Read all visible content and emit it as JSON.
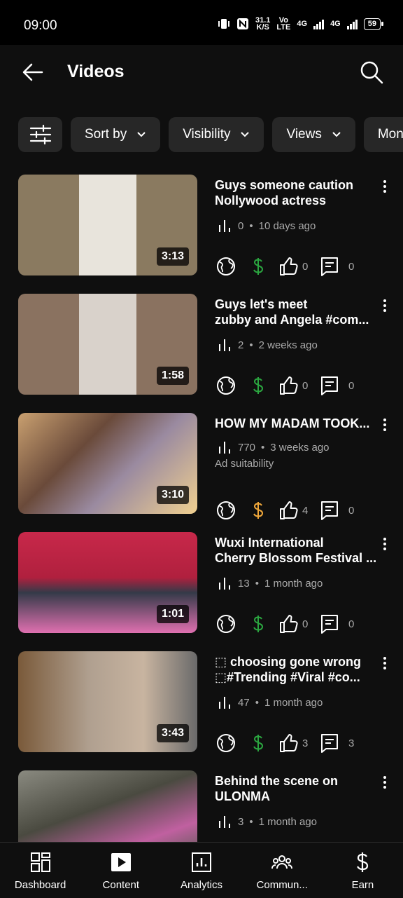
{
  "status": {
    "time": "09:00",
    "speed_value": "31.1",
    "speed_unit": "K/S",
    "volte_top": "Vo",
    "volte_bottom": "LTE",
    "net1": "4G",
    "net2": "4G",
    "battery": "59"
  },
  "header": {
    "title": "Videos"
  },
  "chips": [
    {
      "label": "Sort by"
    },
    {
      "label": "Visibility"
    },
    {
      "label": "Views"
    },
    {
      "label": "Mon"
    }
  ],
  "colors": {
    "monetized": "#2ba640",
    "limited": "#f2a93b",
    "background": "#0f0f0f",
    "chip": "#272727"
  },
  "videos": [
    {
      "title1": "Guys someone caution",
      "title2": "Nollywood actress",
      "views": "0",
      "age": "10 days ago",
      "duration": "3:13",
      "ad_suitability": "",
      "monetization": "monetized",
      "likes": "0",
      "comments": "0"
    },
    {
      "title1": "Guys let's meet",
      "title2": "zubby and Angela #com...",
      "views": "2",
      "age": "2 weeks ago",
      "duration": "1:58",
      "ad_suitability": "",
      "monetization": "monetized",
      "likes": "0",
      "comments": "0"
    },
    {
      "title1": "HOW MY MADAM TOOK...",
      "title2": "",
      "views": "770",
      "age": "3 weeks ago",
      "duration": "3:10",
      "ad_suitability": "Ad suitability",
      "monetization": "limited",
      "likes": "4",
      "comments": "0"
    },
    {
      "title1": "Wuxi International",
      "title2": "Cherry Blossom Festival ...",
      "views": "13",
      "age": "1 month ago",
      "duration": "1:01",
      "ad_suitability": "",
      "monetization": "monetized",
      "likes": "0",
      "comments": "0"
    },
    {
      "title1": "⬚ choosing gone wrong",
      "title2": "⬚#Trending #Viral #co...",
      "views": "47",
      "age": "1 month ago",
      "duration": "3:43",
      "ad_suitability": "",
      "monetization": "monetized",
      "likes": "3",
      "comments": "3"
    },
    {
      "title1": "Behind the scene on",
      "title2": "ULONMA",
      "views": "3",
      "age": "1 month ago",
      "duration": "",
      "ad_suitability": "",
      "monetization": "monetized",
      "likes": "",
      "comments": ""
    }
  ],
  "nav": [
    {
      "label": "Dashboard",
      "icon": "dashboard-icon"
    },
    {
      "label": "Content",
      "icon": "content-icon"
    },
    {
      "label": "Analytics",
      "icon": "analytics-icon"
    },
    {
      "label": "Commun...",
      "icon": "community-icon"
    },
    {
      "label": "Earn",
      "icon": "earn-icon"
    }
  ]
}
